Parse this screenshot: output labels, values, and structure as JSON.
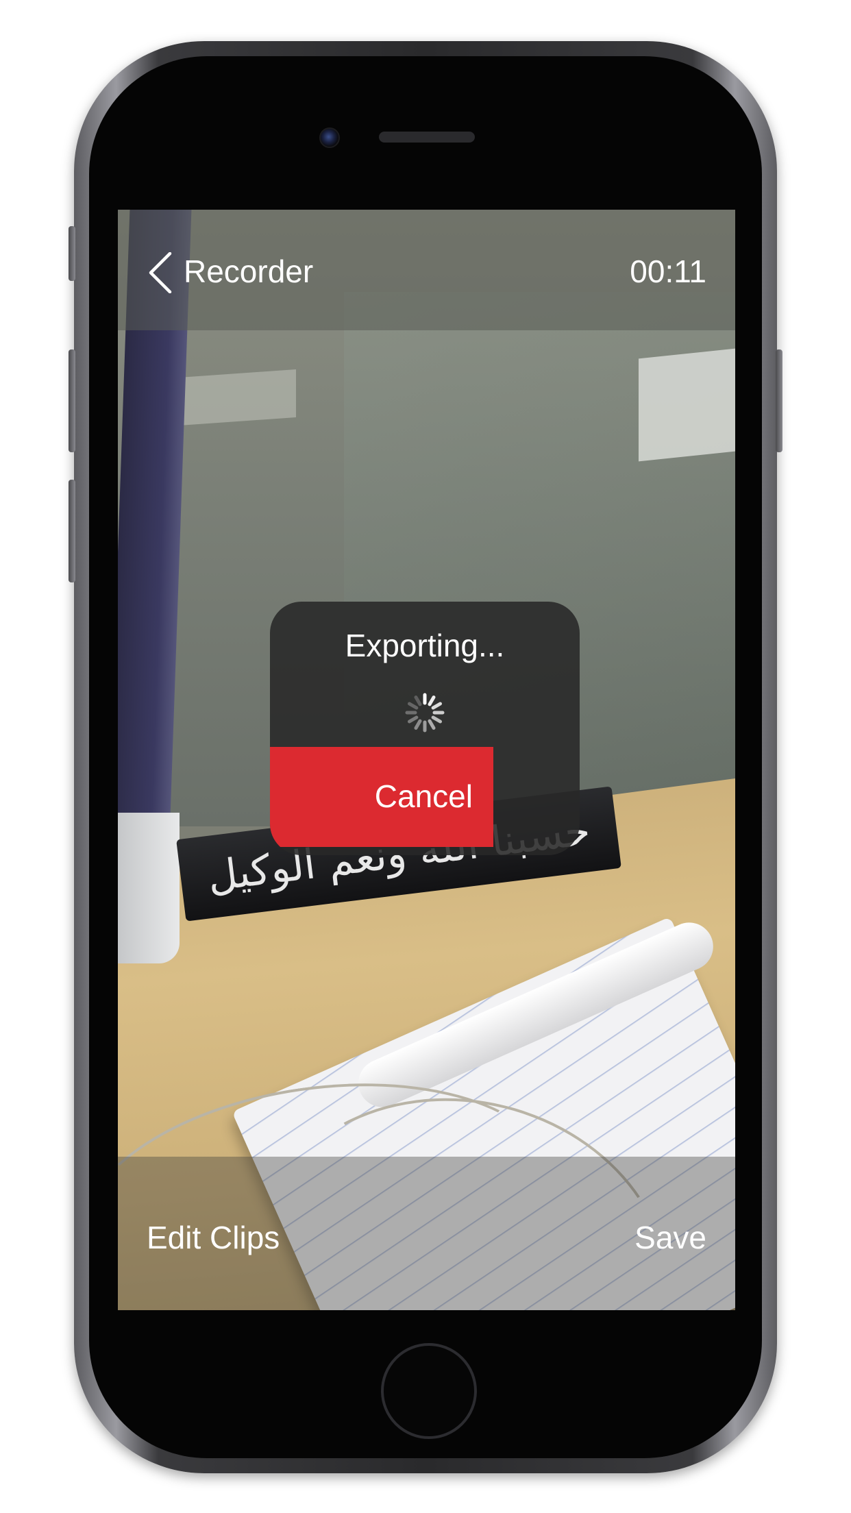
{
  "nav": {
    "back_label": "Recorder",
    "timer": "00:11"
  },
  "dialog": {
    "title": "Exporting...",
    "cancel_label": "Cancel"
  },
  "toolbar": {
    "edit_clips_label": "Edit Clips",
    "save_label": "Save"
  },
  "scene": {
    "nameplate_text": "حسبنا الله ونعم الوكيل"
  },
  "colors": {
    "accent_red": "#dc2a30",
    "dialog_bg": "#282828",
    "text": "#ffffff"
  },
  "icons": {
    "back": "chevron-left-icon",
    "loading": "activity-spinner-icon"
  }
}
